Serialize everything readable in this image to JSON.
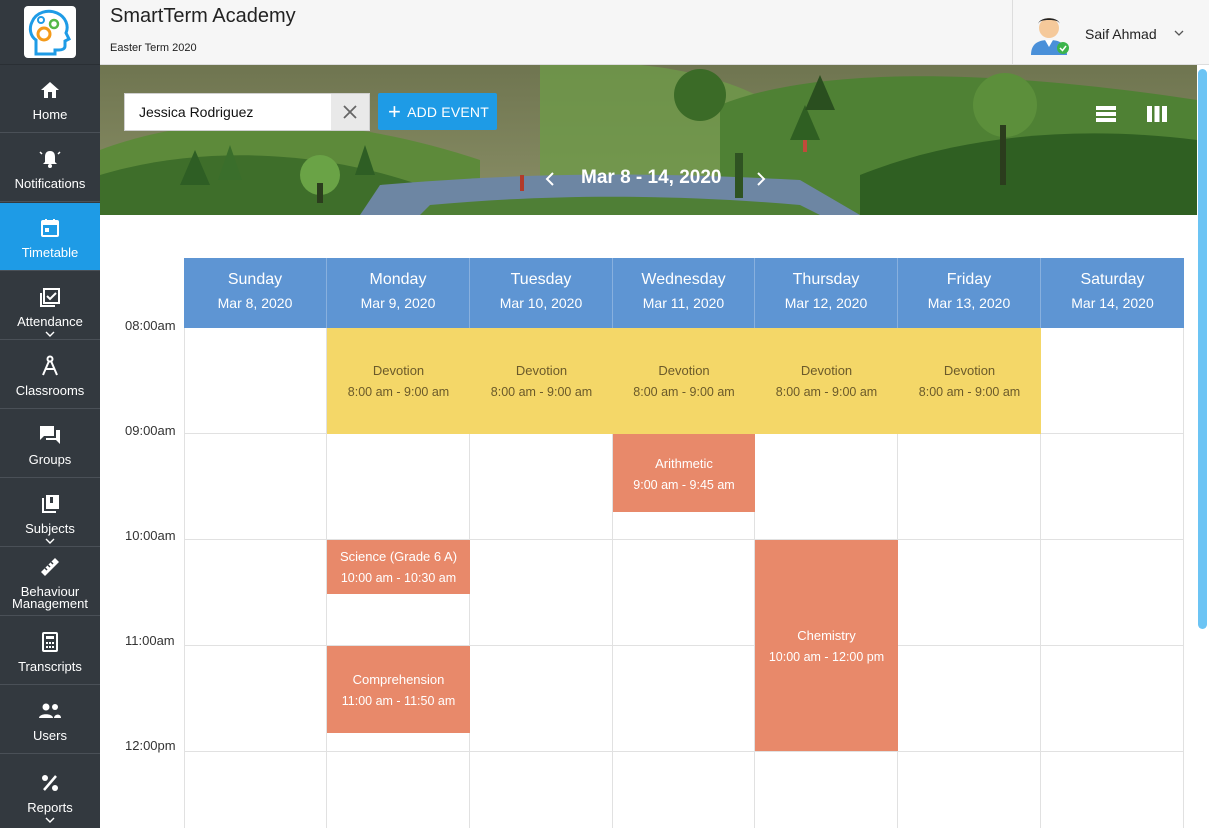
{
  "app": {
    "school_name": "SmartTerm Academy",
    "term": "Easter Term 2020"
  },
  "user": {
    "name": "Saif Ahmad"
  },
  "sidebar": {
    "items": [
      {
        "label": "Home",
        "icon": "home-icon"
      },
      {
        "label": "Notifications",
        "icon": "bell-icon"
      },
      {
        "label": "Timetable",
        "icon": "calendar-icon",
        "active": true
      },
      {
        "label": "Attendance",
        "icon": "calendar-check-icon"
      },
      {
        "label": "Classrooms",
        "icon": "compass-icon"
      },
      {
        "label": "Groups",
        "icon": "chat-icon"
      },
      {
        "label": "Subjects",
        "icon": "book-icon"
      },
      {
        "label": "Behaviour Management",
        "icon": "ruler-icon"
      },
      {
        "label": "Transcripts",
        "icon": "calculator-icon"
      },
      {
        "label": "Users",
        "icon": "users-icon"
      },
      {
        "label": "Reports",
        "icon": "percent-icon"
      }
    ]
  },
  "toolbar": {
    "search_value": "Jessica Rodriguez",
    "add_event_label": "ADD EVENT",
    "week_label": "Mar 8 - 14, 2020"
  },
  "calendar": {
    "days": [
      {
        "name": "Sunday",
        "date": "Mar 8, 2020"
      },
      {
        "name": "Monday",
        "date": "Mar 9, 2020"
      },
      {
        "name": "Tuesday",
        "date": "Mar 10, 2020"
      },
      {
        "name": "Wednesday",
        "date": "Mar 11, 2020"
      },
      {
        "name": "Thursday",
        "date": "Mar 12, 2020"
      },
      {
        "name": "Friday",
        "date": "Mar 13, 2020"
      },
      {
        "name": "Saturday",
        "date": "Mar 14, 2020"
      }
    ],
    "times": [
      "08:00am",
      "09:00am",
      "10:00am",
      "11:00am",
      "12:00pm"
    ],
    "events": [
      {
        "title": "Devotion",
        "time": "8:00 am - 9:00 am",
        "day": 1
      },
      {
        "title": "Devotion",
        "time": "8:00 am - 9:00 am",
        "day": 2
      },
      {
        "title": "Devotion",
        "time": "8:00 am - 9:00 am",
        "day": 3
      },
      {
        "title": "Devotion",
        "time": "8:00 am - 9:00 am",
        "day": 4
      },
      {
        "title": "Devotion",
        "time": "8:00 am - 9:00 am",
        "day": 5
      },
      {
        "title": "Arithmetic",
        "time": "9:00 am - 9:45 am",
        "day": 3
      },
      {
        "title": "Science (Grade 6 A)",
        "time": "10:00 am - 10:30 am",
        "day": 1
      },
      {
        "title": "Comprehension",
        "time": "11:00 am - 11:50 am",
        "day": 1
      },
      {
        "title": "Chemistry",
        "time": "10:00 am - 12:00 pm",
        "day": 4
      }
    ]
  },
  "colors": {
    "sidebar": "#33393f",
    "accent": "#1e9be6",
    "header": "#5e95d3",
    "event_yellow": "#f4d768",
    "event_orange": "#e8896a"
  }
}
